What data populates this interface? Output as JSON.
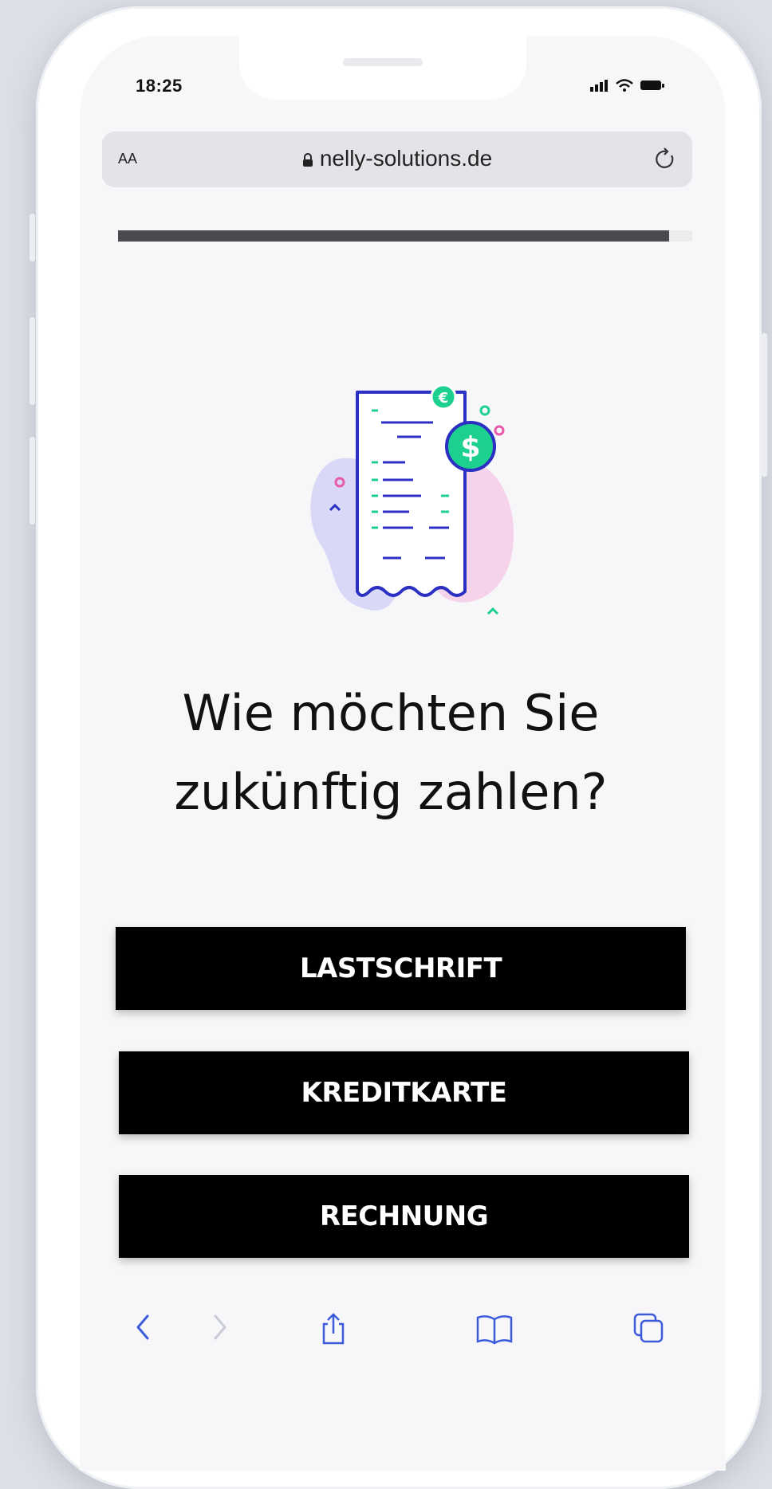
{
  "status_bar": {
    "time": "18:25"
  },
  "browser": {
    "text_size_label": "AA",
    "url": "nelly-solutions.de"
  },
  "progress": {
    "fraction": 0.96,
    "color": "#4a4a50"
  },
  "illustration": {
    "icon": "receipt-payment-illustration"
  },
  "question": {
    "line1": "Wie möchten Sie",
    "line2": "zukünftig zahlen?"
  },
  "options": [
    {
      "label": "LASTSCHRIFT"
    },
    {
      "label": "KREDITKARTE"
    },
    {
      "label": "RECHNUNG"
    }
  ],
  "toolbar": {
    "icons": [
      "back-icon",
      "forward-icon",
      "share-icon",
      "bookmarks-icon",
      "tabs-icon"
    ],
    "accent": "#3b5bdb"
  },
  "colors": {
    "button_bg": "#000000",
    "button_text": "#ffffff",
    "illustration_green": "#1ed08f",
    "illustration_blue": "#2b2fc2",
    "illustration_blob_purple": "#d9d8f7",
    "illustration_blob_pink": "#f5d3ea"
  }
}
